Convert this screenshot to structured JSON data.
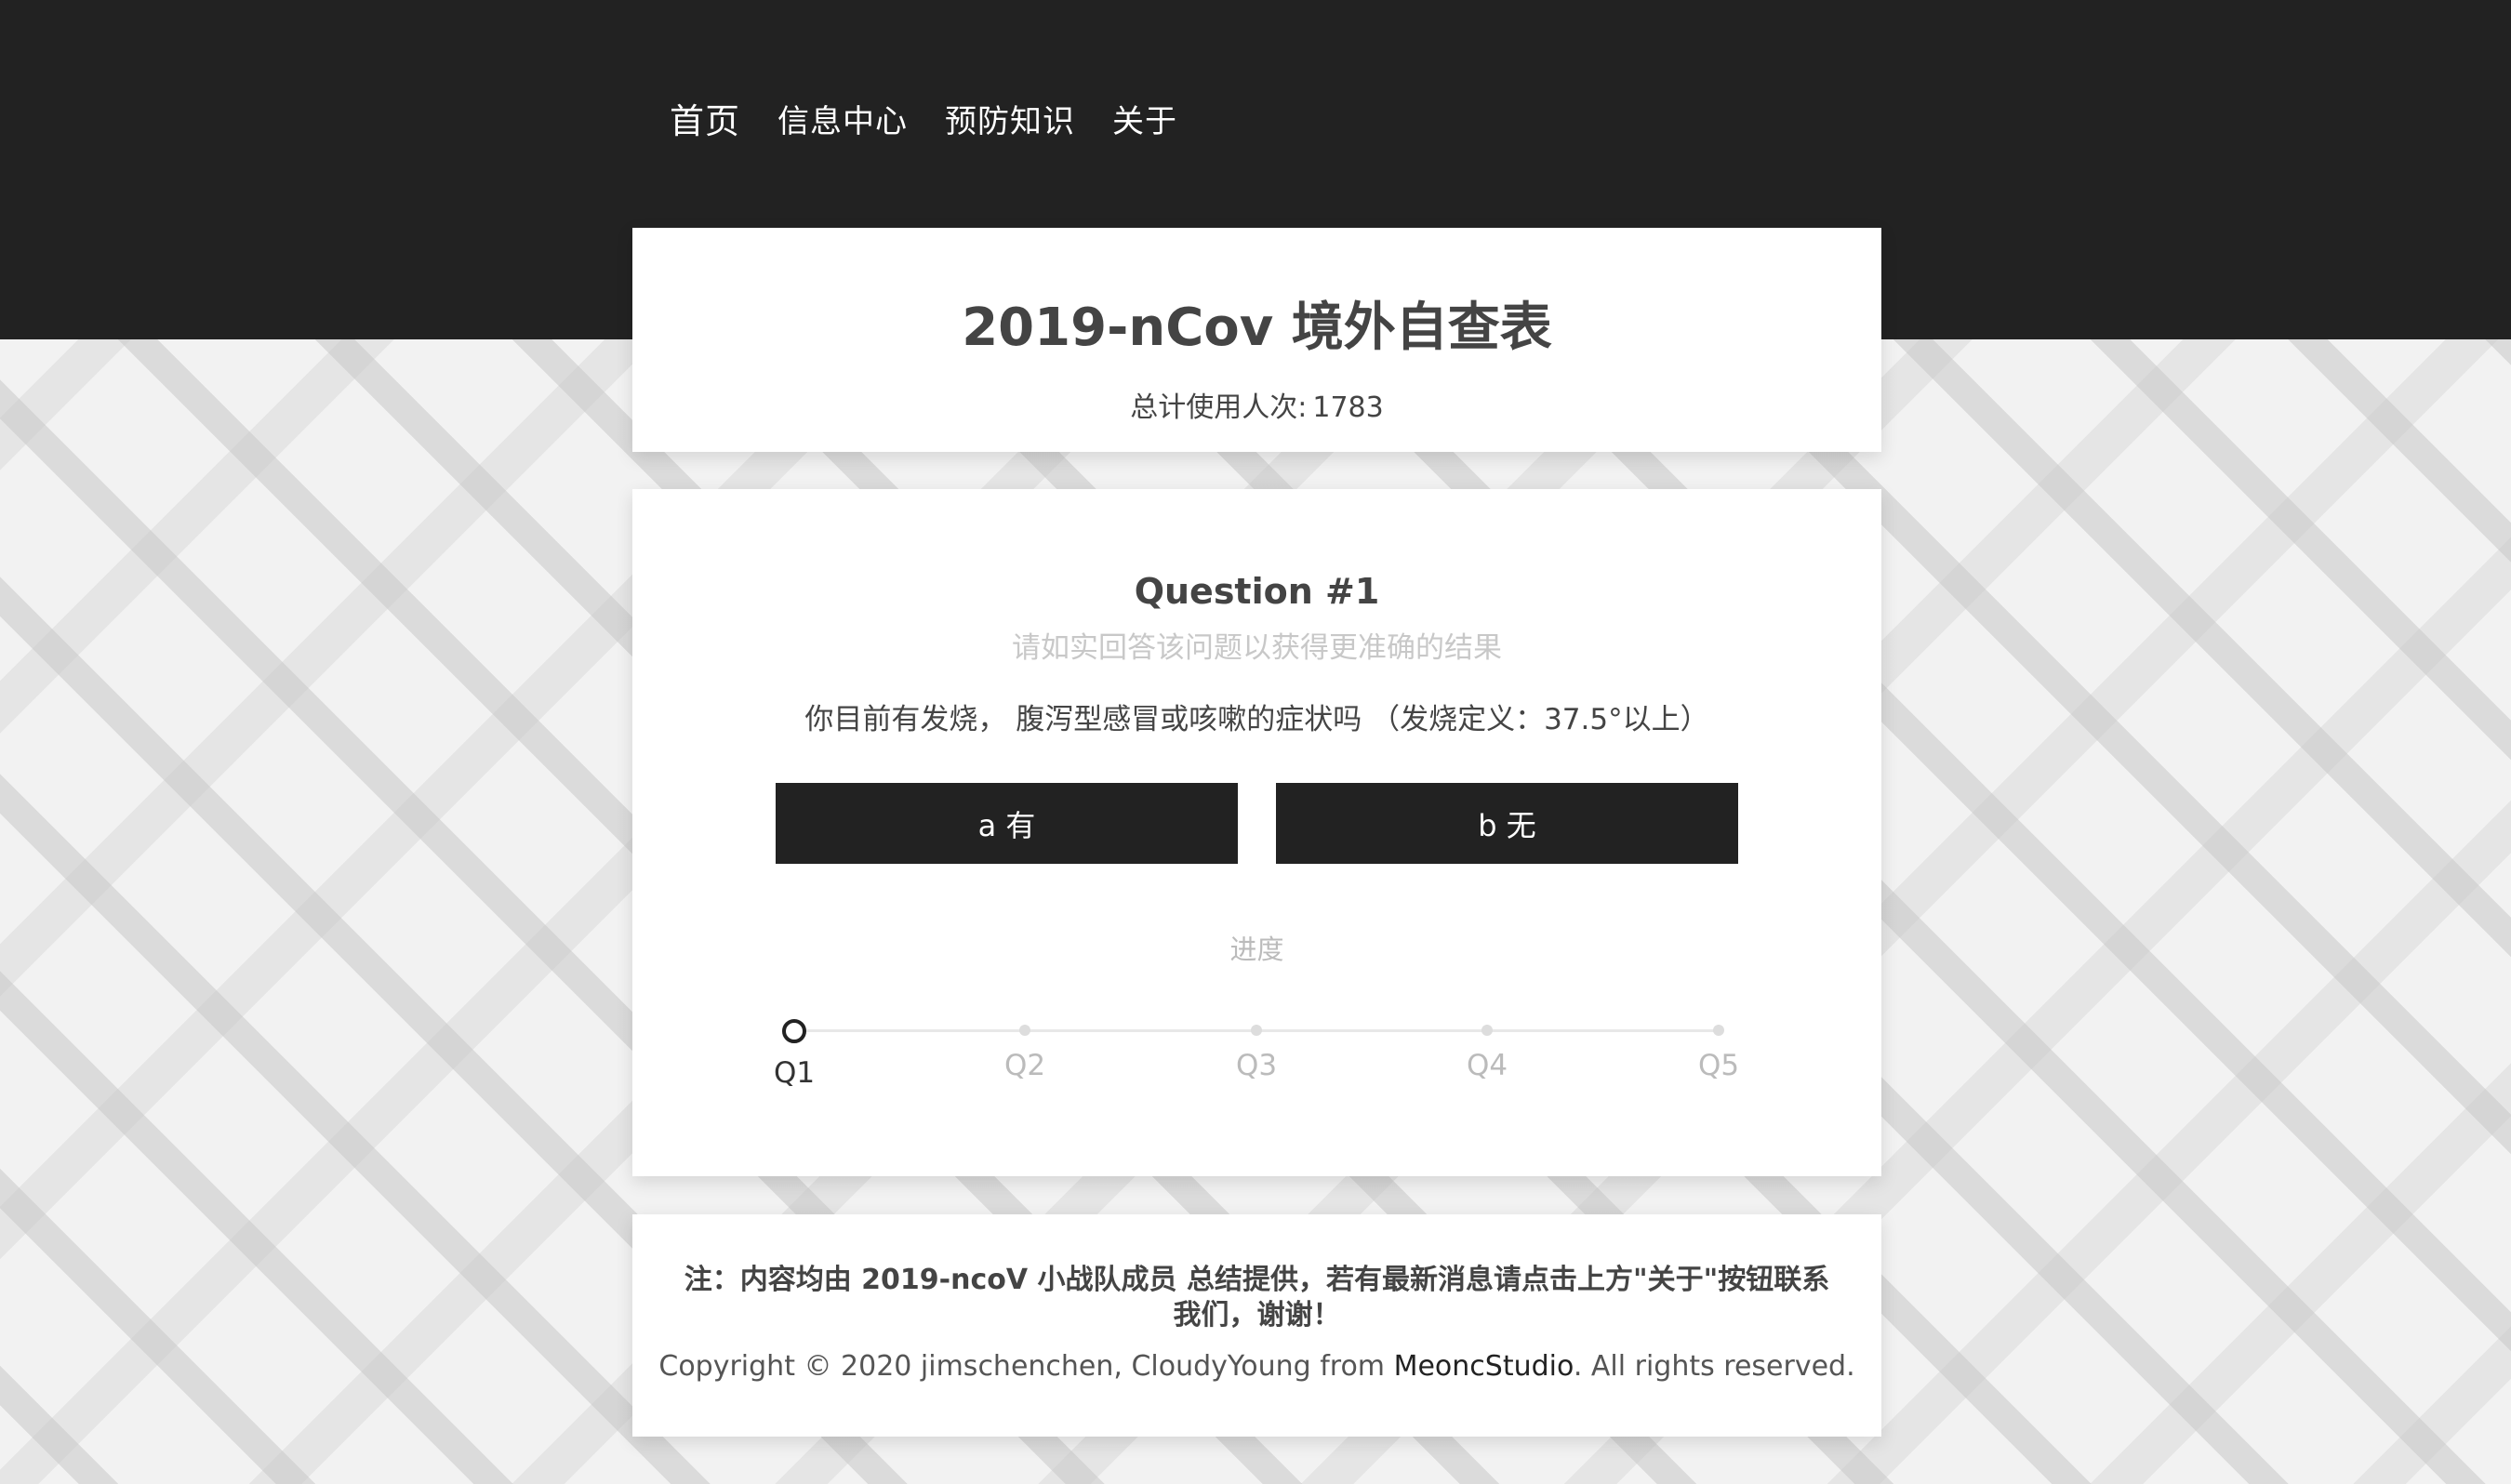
{
  "nav": {
    "items": [
      {
        "label": "首页"
      },
      {
        "label": "信息中心"
      },
      {
        "label": "预防知识"
      },
      {
        "label": "关于"
      }
    ]
  },
  "header": {
    "title": "2019-nCov 境外自查表",
    "usage_label": "总计使用人次:",
    "usage_count": "1783"
  },
  "quiz": {
    "question_title": "Question #1",
    "hint": "请如实回答该问题以获得更准确的结果",
    "question_text": "你目前有发烧， 腹泻型感冒或咳嗽的症状吗 （发烧定义：37.5°以上）",
    "answers": [
      {
        "label": "a 有"
      },
      {
        "label": "b 无"
      }
    ],
    "progress_label": "进度",
    "progress_current_step": 1,
    "steps": [
      {
        "label": "Q1"
      },
      {
        "label": "Q2"
      },
      {
        "label": "Q3"
      },
      {
        "label": "Q4"
      },
      {
        "label": "Q5"
      }
    ]
  },
  "footer": {
    "note": "注：内容均由 2019-ncoV 小战队成员 总结提供，若有最新消息请点击上方\"关于\"按钮联系我们，谢谢！",
    "copyright_prefix": "Copyright © 2020 jimschenchen, CloudyYoung from ",
    "studio_link": "MeoncStudio",
    "copyright_suffix": ". All rights reserved."
  },
  "colors": {
    "topbar": "#222222",
    "button": "#222222",
    "text": "#444444",
    "muted": "#c8c8c8"
  }
}
